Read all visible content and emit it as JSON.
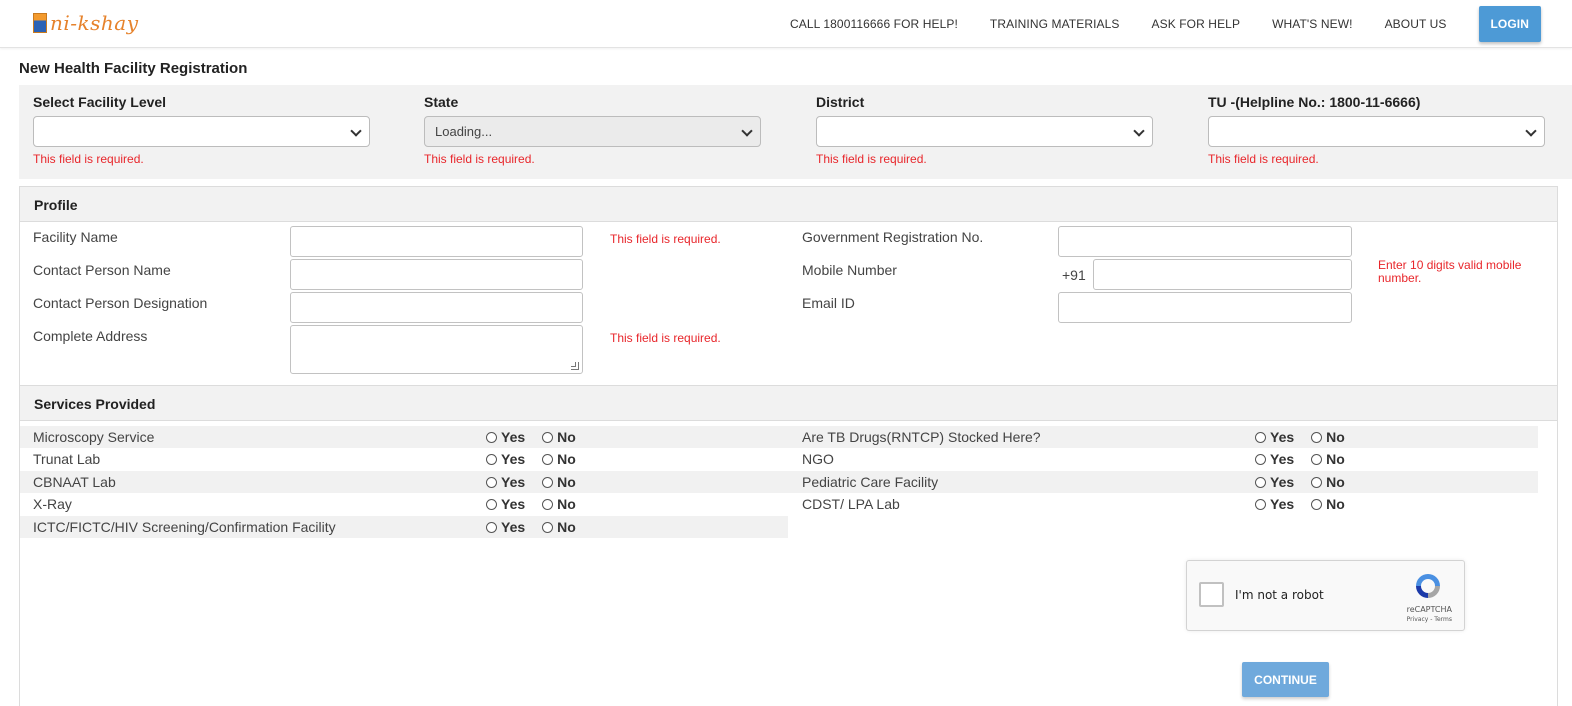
{
  "app": {
    "logo_text": "ni-kshay"
  },
  "nav": {
    "call": "CALL 1800116666 FOR HELP!",
    "training": "TRAINING MATERIALS",
    "ask": "ASK FOR HELP",
    "whats_new": "WHAT'S NEW!",
    "about": "ABOUT US",
    "login": "LOGIN"
  },
  "page_title": "New Health Facility Registration",
  "location": {
    "facility_level": {
      "label": "Select Facility Level",
      "value": "",
      "error": "This field is required."
    },
    "state": {
      "label": "State",
      "value": "Loading...",
      "error": "This field is required."
    },
    "district": {
      "label": "District",
      "value": "",
      "error": "This field is required."
    },
    "tu": {
      "label": "TU -(Helpline No.: 1800-11-6666)",
      "value": "",
      "error": "This field is required."
    }
  },
  "profile": {
    "heading": "Profile",
    "facility_name": {
      "label": "Facility Name",
      "value": "",
      "error": "This field is required."
    },
    "contact_name": {
      "label": "Contact Person Name",
      "value": ""
    },
    "contact_designation": {
      "label": "Contact Person Designation",
      "value": ""
    },
    "address": {
      "label": "Complete Address",
      "value": "",
      "error": "This field is required."
    },
    "gov_reg": {
      "label": "Government Registration No.",
      "value": ""
    },
    "mobile": {
      "label": "Mobile Number",
      "prefix": "+91",
      "value": "",
      "error": "Enter 10 digits valid mobile number."
    },
    "email": {
      "label": "Email ID",
      "value": ""
    }
  },
  "services": {
    "heading": "Services Provided",
    "yes": "Yes",
    "no": "No",
    "left": [
      "Microscopy Service",
      "Trunat Lab",
      "CBNAAT Lab",
      "X-Ray",
      "ICTC/FICTC/HIV Screening/Confirmation Facility"
    ],
    "right": [
      "Are TB Drugs(RNTCP) Stocked Here?",
      "NGO",
      "Pediatric Care Facility",
      "CDST/ LPA Lab"
    ]
  },
  "captcha": {
    "label": "I'm not a robot",
    "brand": "reCAPTCHA",
    "links": "Privacy - Terms"
  },
  "continue_label": "CONTINUE",
  "colors": {
    "accent": "#4d9ad6",
    "error": "#e8262b",
    "logo": "#e6822b"
  }
}
